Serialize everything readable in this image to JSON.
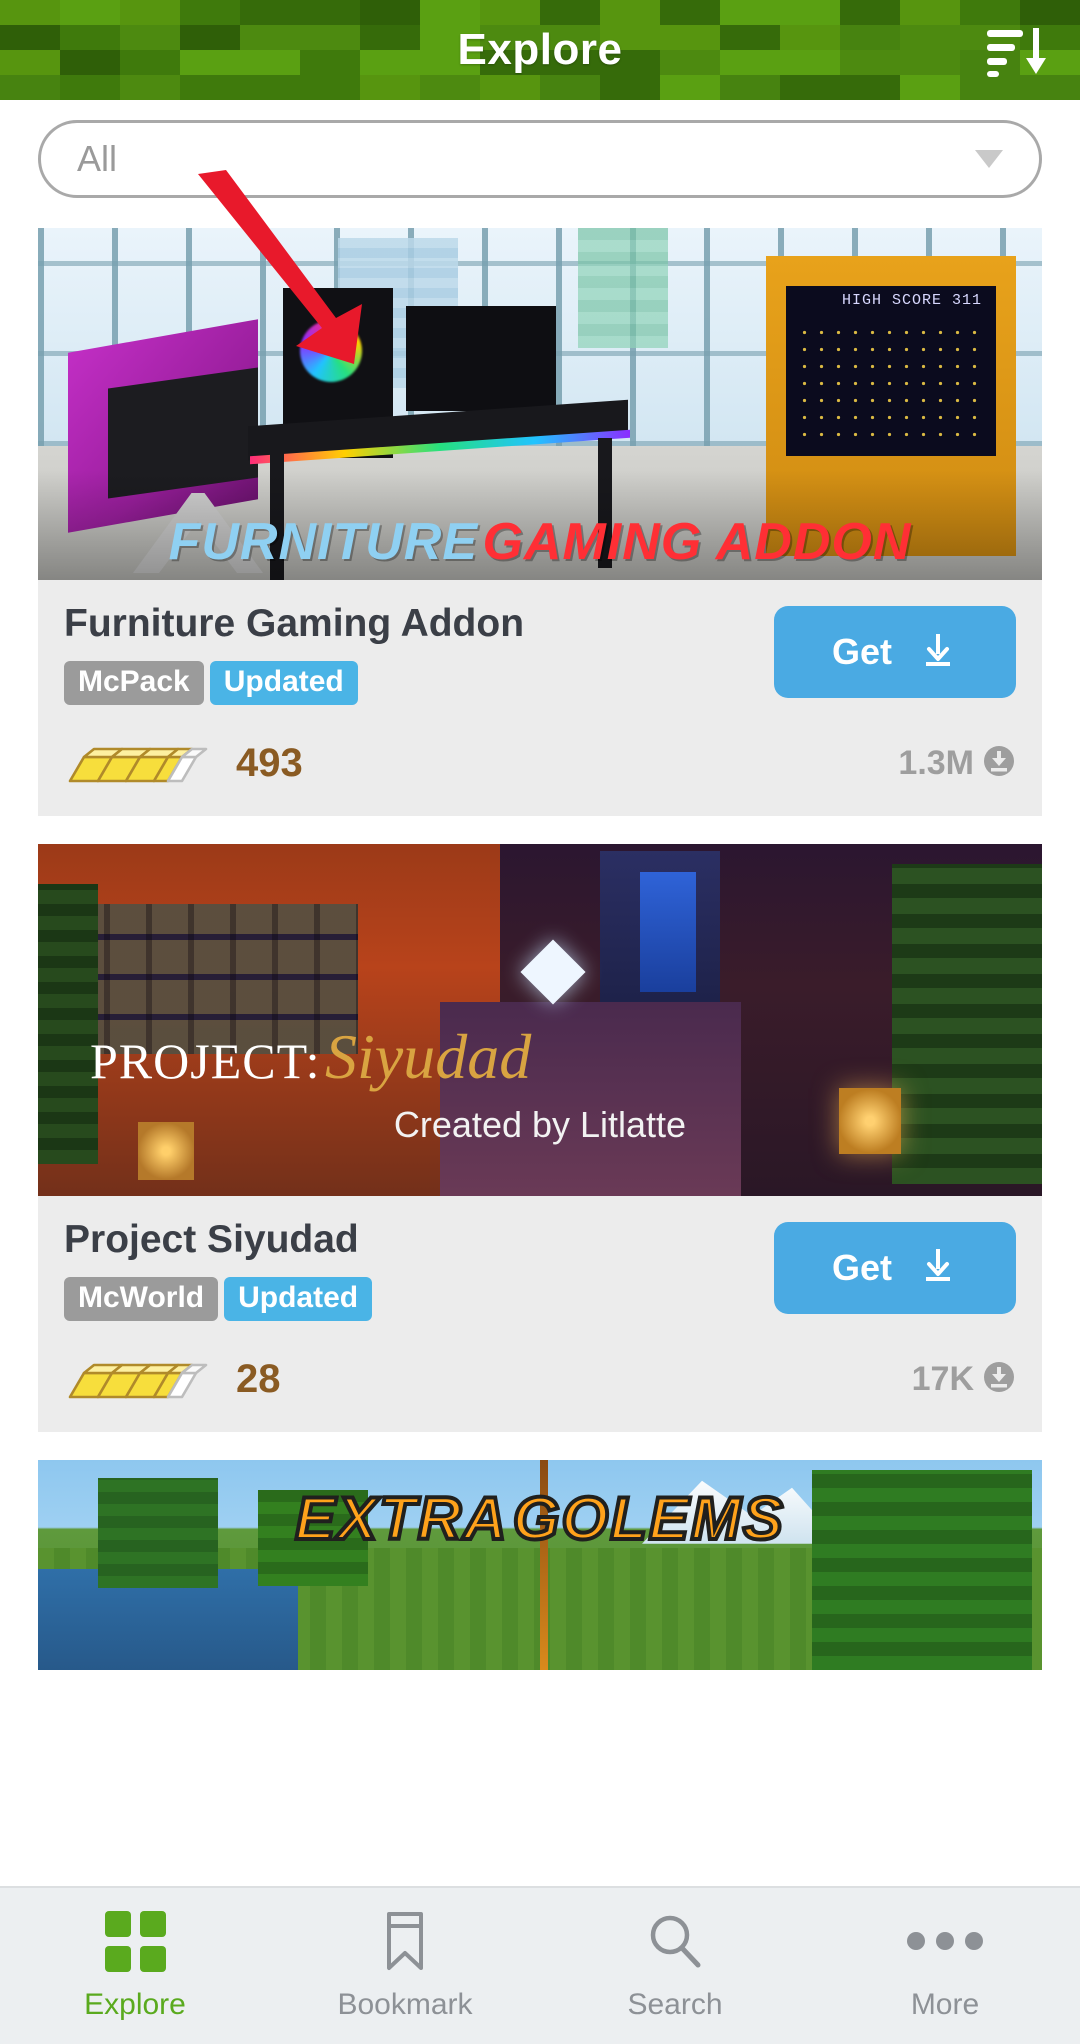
{
  "header": {
    "title": "Explore",
    "sort_icon": "sort-descending-icon"
  },
  "filter": {
    "selected": "All",
    "caret_icon": "chevron-down-icon"
  },
  "cards": [
    {
      "title": "Furniture Gaming Addon",
      "type_badge": "McPack",
      "status_badge": "Updated",
      "rating_count": "493",
      "downloads": "1.3M",
      "get_label": "Get",
      "thumb_caption_a": "FURNITURE",
      "thumb_caption_b": "GAMING ADDON",
      "thumb_hiscore": "HIGH SCORE 311"
    },
    {
      "title": "Project Siyudad",
      "type_badge": "McWorld",
      "status_badge": "Updated",
      "rating_count": "28",
      "downloads": "17K",
      "get_label": "Get",
      "thumb_caption_a": "PROJECT:",
      "thumb_caption_b": "Siyudad",
      "thumb_subcaption": "Created by Litlatte"
    },
    {
      "thumb_caption_a": "EXTRA",
      "thumb_caption_b": "GOLEMS"
    }
  ],
  "bottom_nav": [
    {
      "label": "Explore",
      "icon": "grid-icon",
      "active": true
    },
    {
      "label": "Bookmark",
      "icon": "bookmark-icon",
      "active": false
    },
    {
      "label": "Search",
      "icon": "search-icon",
      "active": false
    },
    {
      "label": "More",
      "icon": "ellipsis-icon",
      "active": false
    }
  ],
  "annotation": {
    "type": "red-arrow",
    "color": "#e8192b"
  },
  "colors": {
    "header_green": "#3f7a0c",
    "accent_blue": "#4aaae3",
    "badge_gray": "#9b9b9b",
    "rating_brown": "#8a5b23",
    "nav_active_green": "#5aaa1e"
  }
}
